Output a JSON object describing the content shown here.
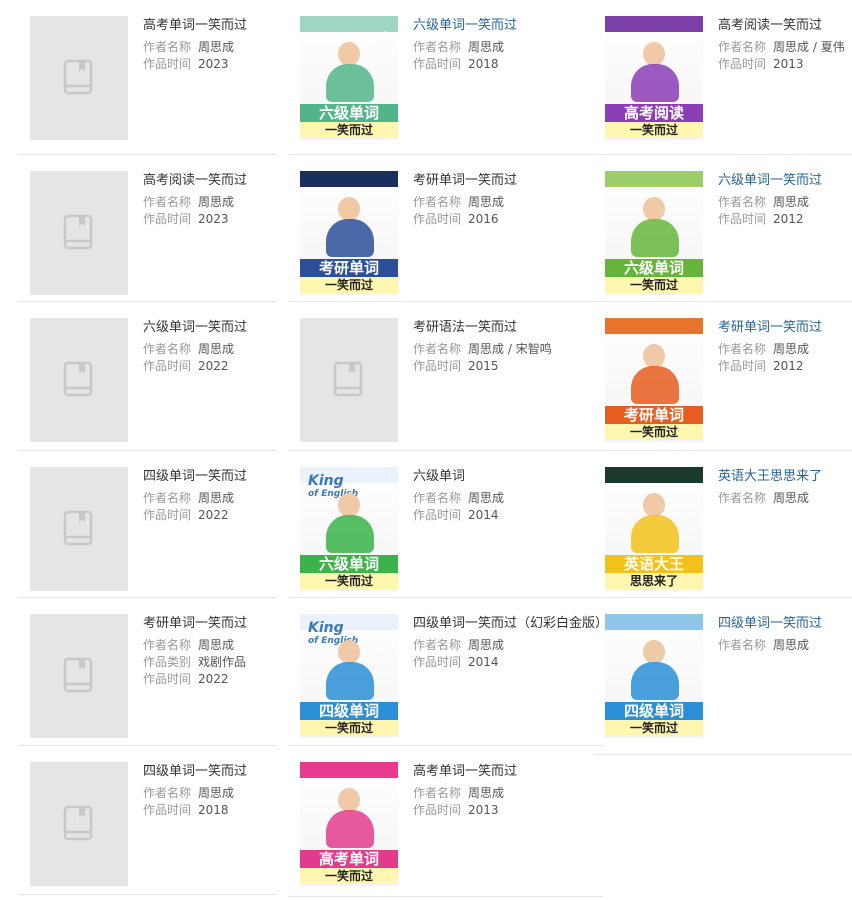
{
  "labels": {
    "author": "作者名称",
    "time": "作品时间",
    "category": "作品类别"
  },
  "columns": [
    {
      "items": [
        {
          "title": "高考单词一笑而过",
          "author": "周思成",
          "time": "2023",
          "cover": "placeholder",
          "link": false
        },
        {
          "title": "高考阅读一笑而过",
          "author": "周思成",
          "time": "2023",
          "cover": "placeholder",
          "link": false
        },
        {
          "title": "六级单词一笑而过",
          "author": "周思成",
          "time": "2022",
          "cover": "placeholder",
          "link": false
        },
        {
          "title": "四级单词一笑而过",
          "author": "周思成",
          "time": "2022",
          "cover": "placeholder",
          "link": false
        },
        {
          "title": "考研单词一笑而过",
          "author": "周思成",
          "category": "戏剧作品",
          "time": "2022",
          "cover": "placeholder",
          "link": false
        },
        {
          "title": "四级单词一笑而过",
          "author": "周思成",
          "time": "2018",
          "cover": "placeholder",
          "link": false
        }
      ]
    },
    {
      "items": [
        {
          "title": "六级单词一笑而过",
          "author": "周思成",
          "time": "2018",
          "cover": "book-cet6-2018",
          "link": true
        },
        {
          "title": "考研单词一笑而过",
          "author": "周思成",
          "time": "2016",
          "cover": "book-kaoyan-2016",
          "link": false
        },
        {
          "title": "考研语法一笑而过",
          "author": "周思成 / 宋智鸣",
          "time": "2015",
          "cover": "placeholder",
          "link": false
        },
        {
          "title": "六级单词",
          "author": "周思成",
          "time": "2014",
          "cover": "book-cet6-2014",
          "link": false
        },
        {
          "title": "四级单词一笑而过（幻彩白金版）",
          "author": "周思成",
          "time": "2014",
          "cover": "book-cet4-2014",
          "link": false
        },
        {
          "title": "高考单词一笑而过",
          "author": "周思成",
          "time": "2013",
          "cover": "book-gaokao-word-2013",
          "link": false
        }
      ]
    },
    {
      "items": [
        {
          "title": "高考阅读一笑而过",
          "author": "周思成 / 夏伟",
          "time": "2013",
          "cover": "book-gaokao-reading-2013",
          "link": false
        },
        {
          "title": "六级单词一笑而过",
          "author": "周思成",
          "time": "2012",
          "cover": "book-cet6-2012",
          "link": true
        },
        {
          "title": "考研单词一笑而过",
          "author": "周思成",
          "time": "2012",
          "cover": "book-kaoyan-2012",
          "link": true
        },
        {
          "title": "英语大王思思来了",
          "author": "周思成",
          "cover": "book-english-king",
          "link": true
        },
        {
          "title": "四级单词一笑而过",
          "author": "周思成",
          "cover": "book-cet4-2012",
          "link": true
        }
      ]
    }
  ],
  "covers": {
    "book-cet6-2018": {
      "main": "六级单词",
      "sub": "一笑而过",
      "badge": "6",
      "top": "#9fd6c4",
      "color": "#52b58a"
    },
    "book-kaoyan-2016": {
      "main": "考研单词",
      "sub": "一笑而过",
      "top": "#1b2f5e",
      "color": "#2b4f9a"
    },
    "book-cet6-2014": {
      "main": "六级单词",
      "sub": "一笑而过",
      "brand": "King",
      "brand_sub": "of English",
      "top": "#eaf3fb",
      "color": "#3bb34a"
    },
    "book-cet4-2014": {
      "main": "四级单词",
      "sub": "一笑而过",
      "brand": "King",
      "brand_sub": "of English",
      "top": "#eaf3fb",
      "color": "#2a8fd6"
    },
    "book-gaokao-word-2013": {
      "main": "高考单词",
      "sub": "一笑而过",
      "top": "#e83b8f",
      "color": "#e23b8e"
    },
    "book-gaokao-reading-2013": {
      "main": "高考阅读",
      "sub": "一笑而过",
      "top": "#7b3fa6",
      "color": "#8a3db5"
    },
    "book-cet6-2012": {
      "main": "六级单词",
      "sub": "一笑而过",
      "top": "#9ccf6b",
      "color": "#66b53a"
    },
    "book-kaoyan-2012": {
      "main": "考研单词",
      "sub": "一笑而过",
      "top": "#e8742c",
      "color": "#e85d1f"
    },
    "book-english-king": {
      "main": "英语大王",
      "sub": "思思来了",
      "top": "#1b3a2c",
      "color": "#f2c21b"
    },
    "book-cet4-2012": {
      "main": "四级单词",
      "sub": "一笑而过",
      "top": "#8fc6e8",
      "color": "#2a8fd6"
    }
  }
}
